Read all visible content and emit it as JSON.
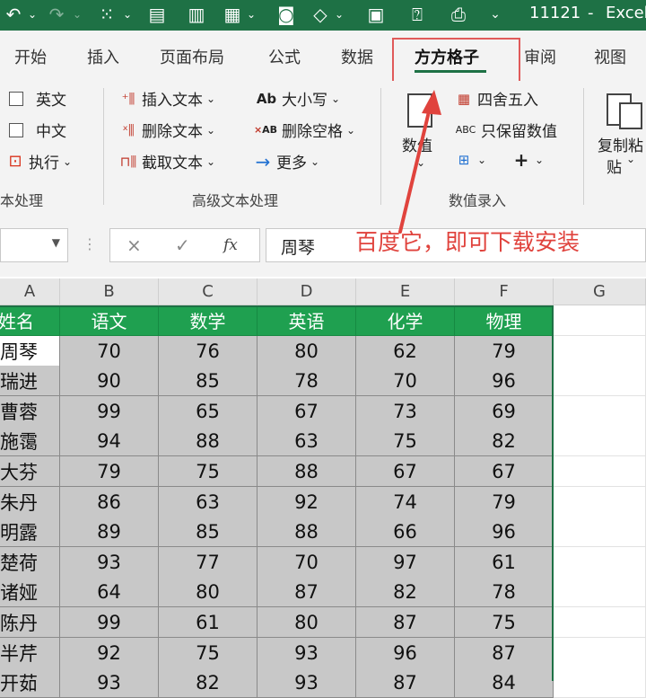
{
  "titlebar": {
    "filename": "11121",
    "app": "Excel",
    "sep": "-"
  },
  "tabs": [
    {
      "label": "开始"
    },
    {
      "label": "插入"
    },
    {
      "label": "页面布局"
    },
    {
      "label": "公式"
    },
    {
      "label": "数据"
    },
    {
      "label": "方方格子",
      "active": true
    },
    {
      "label": "审阅"
    },
    {
      "label": "视图"
    }
  ],
  "ribbon": {
    "text_group": {
      "label": "本处理",
      "items": [
        "英文",
        "中文",
        "执行"
      ]
    },
    "advanced_group": {
      "label": "高级文本处理",
      "items": [
        "插入文本",
        "删除文本",
        "截取文本",
        "大小写",
        "删除空格",
        "更多"
      ]
    },
    "number_group": {
      "label": "数值录入",
      "value_label": "数值",
      "items": [
        "四舍五入",
        "只保留数值"
      ]
    },
    "copy_group": {
      "line1": "复制粘",
      "line2": "贴"
    }
  },
  "formula_bar": {
    "cancel": "×",
    "confirm": "✓",
    "fx": "fx",
    "value": "周琴"
  },
  "annotation": "百度它，即可下载安装",
  "columns": [
    "A",
    "B",
    "C",
    "D",
    "E",
    "F",
    "G"
  ],
  "table": {
    "headers": [
      "姓名",
      "语文",
      "数学",
      "英语",
      "化学",
      "物理"
    ],
    "rows": [
      [
        "周琴",
        "70",
        "76",
        "80",
        "62",
        "79"
      ],
      [
        "瑞进",
        "90",
        "85",
        "78",
        "70",
        "96"
      ],
      [
        "曹蓉",
        "99",
        "65",
        "67",
        "73",
        "69"
      ],
      [
        "施霭",
        "94",
        "88",
        "63",
        "75",
        "82"
      ],
      [
        "大芬",
        "79",
        "75",
        "88",
        "67",
        "67"
      ],
      [
        "朱丹",
        "86",
        "63",
        "92",
        "74",
        "79"
      ],
      [
        "明露",
        "89",
        "85",
        "88",
        "66",
        "96"
      ],
      [
        "楚荷",
        "93",
        "77",
        "70",
        "97",
        "61"
      ],
      [
        "诸娅",
        "64",
        "80",
        "87",
        "82",
        "78"
      ],
      [
        "陈丹",
        "99",
        "61",
        "80",
        "87",
        "75"
      ],
      [
        "半芹",
        "92",
        "75",
        "93",
        "96",
        "87"
      ],
      [
        "开茹",
        "93",
        "82",
        "93",
        "87",
        "84"
      ]
    ]
  },
  "colors": {
    "title_bg": "#1e7145",
    "header_fill": "#1fa050",
    "body_fill": "#c8c8c8",
    "annotation": "#e0433d"
  }
}
